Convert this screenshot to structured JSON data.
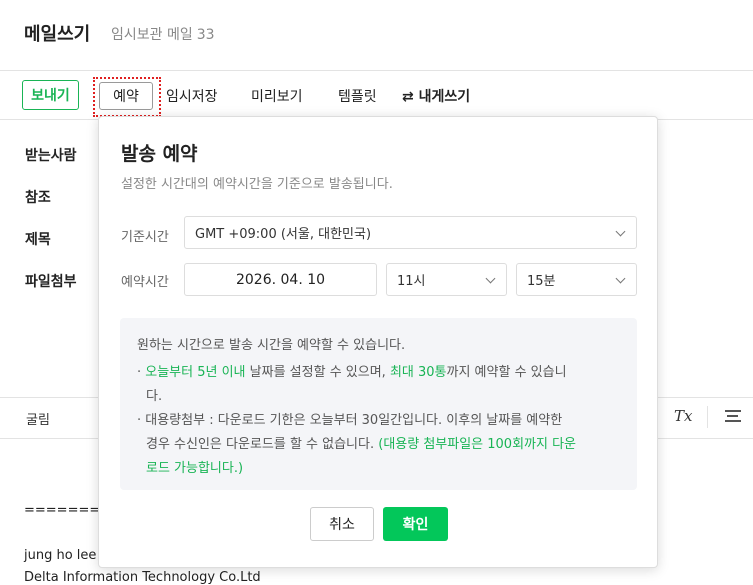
{
  "header": {
    "title": "메일쓰기",
    "subtitle": "임시보관 메일",
    "draft_count": "33"
  },
  "toolbar": {
    "send": "보내기",
    "reserve": "예약",
    "save_draft": "임시저장",
    "preview": "미리보기",
    "template": "템플릿",
    "self_write": "⇄ 내게쓰기"
  },
  "fields": {
    "to": "받는사람",
    "cc": "참조",
    "subject": "제목",
    "attach": "파일첨부"
  },
  "editor": {
    "font": "굴림",
    "clear_format": "Tx"
  },
  "body_text": {
    "separator": "===========",
    "name": "jung ho lee",
    "company": "Delta Information Technology Co.Ltd"
  },
  "popup": {
    "title": "발송 예약",
    "subtitle": "설정한 시간대의 예약시간을 기준으로 발송됩니다.",
    "timezone_label": "기준시간",
    "timezone_value": "GMT +09:00 (서울, 대한민국)",
    "time_label": "예약시간",
    "date": "2026. 04. 10",
    "hour": "11시",
    "minute": "15분",
    "info": {
      "heading": "원하는 시간으로 발송 시간을 예약할 수 있습니다.",
      "l1_bullet": "· ",
      "l1_green1": "오늘부터 5년 이내",
      "l1_mid": " 날짜를 설정할 수 있으며, ",
      "l1_green2": "최대 30통",
      "l1_end": "까지 예약할 수 있습니",
      "l1_wrap": "다.",
      "l2_a": "· 대용량첨부 : 다운로드 기한은 오늘부터 30일간입니다. 이후의 날짜를 예약한",
      "l2_b_plain": "경우 수신인은 다운로드를 할 수 없습니다. ",
      "l2_b_green": "(대용량 첨부파일은 100회까지 다운",
      "l2_c_green": "로드 가능합니다.)"
    },
    "cancel": "취소",
    "confirm": "확인"
  }
}
